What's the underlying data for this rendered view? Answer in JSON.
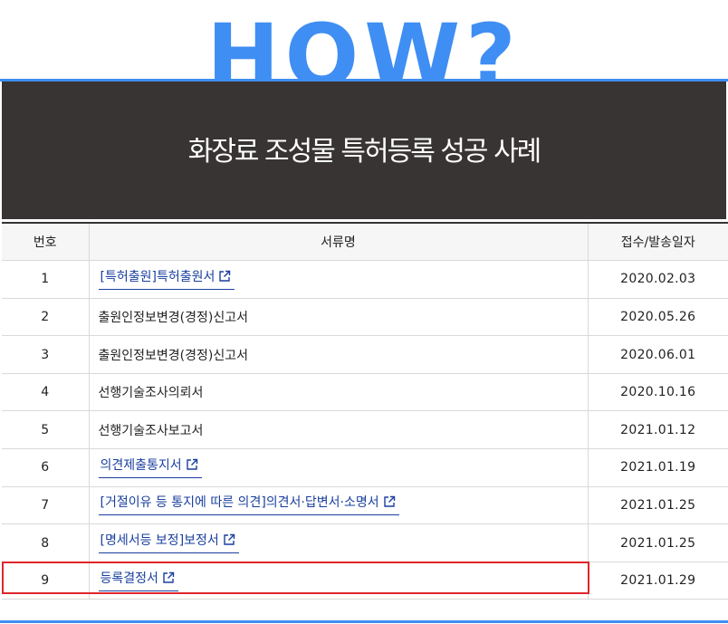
{
  "hero": {
    "text": "HOW?",
    "color": "#3f8ef3"
  },
  "banner": {
    "title": "화장료 조성물 특허등록 성공 사례",
    "background": "#383433"
  },
  "table": {
    "headers": {
      "no": "번호",
      "name": "서류명",
      "date": "접수/발송일자"
    },
    "rows": [
      {
        "no": "1",
        "name": "[특허출원]특허출원서",
        "date": "2020.02.03",
        "link": true,
        "icon": "external-link-icon"
      },
      {
        "no": "2",
        "name": "출원인정보변경(경정)신고서",
        "date": "2020.05.26",
        "link": false
      },
      {
        "no": "3",
        "name": "출원인정보변경(경정)신고서",
        "date": "2020.06.01",
        "link": false
      },
      {
        "no": "4",
        "name": "선행기술조사의뢰서",
        "date": "2020.10.16",
        "link": false
      },
      {
        "no": "5",
        "name": "선행기술조사보고서",
        "date": "2021.01.12",
        "link": false
      },
      {
        "no": "6",
        "name": "의견제출통지서",
        "date": "2021.01.19",
        "link": true,
        "icon": "external-link-icon"
      },
      {
        "no": "7",
        "name": "[거절이유 등 통지에 따른 의견]의견서·답변서·소명서",
        "date": "2021.01.25",
        "link": true,
        "icon": "external-link-icon"
      },
      {
        "no": "8",
        "name": "[명세서등 보정]보정서",
        "date": "2021.01.25",
        "link": true,
        "icon": "external-link-icon"
      },
      {
        "no": "9",
        "name": "등록결정서",
        "date": "2021.01.29",
        "link": true,
        "icon": "external-link-icon",
        "highlighted": true
      }
    ]
  },
  "colors": {
    "accent": "#3f8ef3",
    "link": "#1a3f9e",
    "highlight": "#e0262b"
  }
}
